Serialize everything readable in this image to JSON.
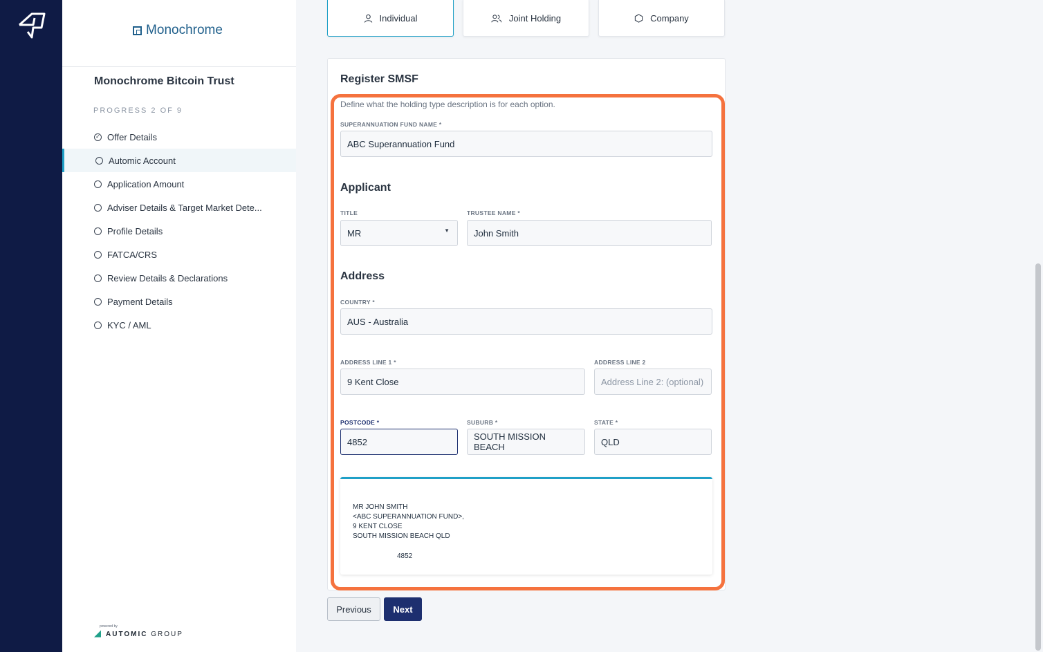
{
  "brand": {
    "name": "Monochrome"
  },
  "sidebar": {
    "fund_title": "Monochrome Bitcoin Trust",
    "progress": "PROGRESS 2 OF 9",
    "steps": [
      {
        "label": "Offer Details",
        "state": "done"
      },
      {
        "label": "Automic Account",
        "state": "active"
      },
      {
        "label": "Application Amount",
        "state": "todo"
      },
      {
        "label": "Adviser Details & Target Market Dete...",
        "state": "todo"
      },
      {
        "label": "Profile Details",
        "state": "todo"
      },
      {
        "label": "FATCA/CRS",
        "state": "todo"
      },
      {
        "label": "Review Details & Declarations",
        "state": "todo"
      },
      {
        "label": "Payment Details",
        "state": "todo"
      },
      {
        "label": "KYC / AML",
        "state": "todo"
      }
    ],
    "powered_by": "powered by",
    "powered_brand_bold": "AUTOMIC",
    "powered_brand_rest": " GROUP"
  },
  "holding_tabs": [
    {
      "label": "Individual",
      "icon": "person-icon",
      "selected": true
    },
    {
      "label": "Joint Holding",
      "icon": "people-icon",
      "selected": false
    },
    {
      "label": "Company",
      "icon": "hexagon-icon",
      "selected": false
    }
  ],
  "form": {
    "title": "Register SMSF",
    "description": "Define what the holding type description is for each option.",
    "fund_name_label": "SUPERANNUATION FUND NAME *",
    "fund_name_value": "ABC Superannuation Fund",
    "applicant_heading": "Applicant",
    "title_label": "TITLE",
    "title_value": "MR",
    "trustee_label": "TRUSTEE NAME *",
    "trustee_value": "John Smith",
    "address_heading": "Address",
    "country_label": "COUNTRY *",
    "country_value": "AUS - Australia",
    "address1_label": "ADDRESS LINE 1 *",
    "address1_value": "9 Kent Close",
    "address2_label": "ADDRESS LINE 2",
    "address2_placeholder": "Address Line 2: (optional)",
    "postcode_label": "POSTCODE *",
    "postcode_value": "4852",
    "suburb_label": "SUBURB *",
    "suburb_value": "SOUTH MISSION BEACH",
    "state_label": "STATE *",
    "state_value": "QLD"
  },
  "preview": {
    "line1": "MR JOHN SMITH",
    "line2": "<ABC SUPERANNUATION FUND>,",
    "line3": "9 KENT CLOSE",
    "line4": "SOUTH MISSION BEACH QLD",
    "postcode": "4852"
  },
  "buttons": {
    "previous": "Previous",
    "next": "Next"
  },
  "colors": {
    "rail": "#0f1b45",
    "accent": "#1fa0c7",
    "primary": "#1d2f6f",
    "highlight": "#f5723e"
  }
}
